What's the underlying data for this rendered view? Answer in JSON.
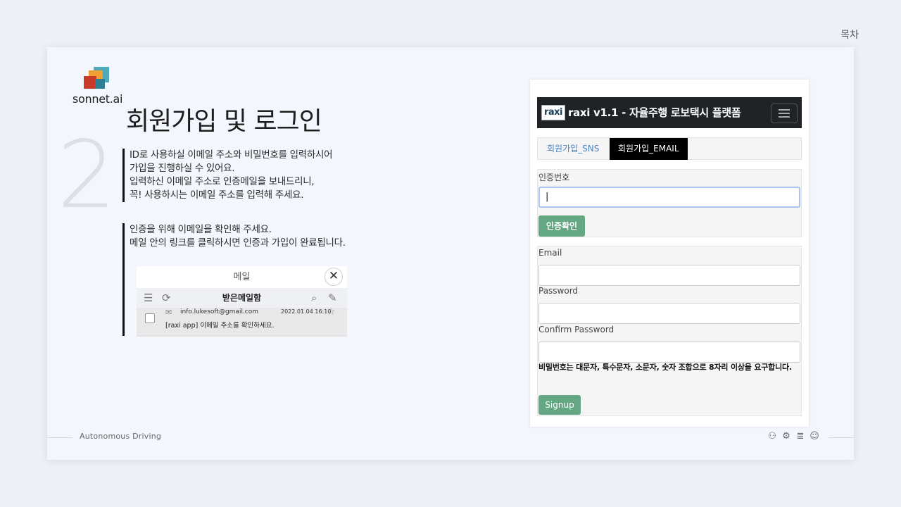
{
  "toc_label": "목차",
  "logo": {
    "text": "sonnet.ai"
  },
  "slide": {
    "title": "회원가입 및 로그인",
    "number": "2",
    "para1": [
      "ID로 사용하실 이메일 주소와 비밀번호를 입력하시어",
      "가입을 진행하실 수 있어요.",
      "입력하신 이메일 주소로 인증메일을 보내드리니,",
      "꼭! 사용하시는 이메일 주소를 입력해 주세요."
    ],
    "para2": [
      "인증을 위해 이메일을 확인해 주세요.",
      "메일 안의 링크를 클릭하시면 인증과 가입이 완료됩니다."
    ]
  },
  "mail": {
    "header": "메일",
    "close_icon": "✕",
    "inbox_title": "받은메일함",
    "from": "info.lukesoft@gmail.com",
    "date": "2022.01.04 16:10",
    "subject": "[raxi app] 이메일 주소를 확인하세요."
  },
  "app": {
    "logo_text": "raxi",
    "nav_title": "raxi v1.1 - 자율주행 로보택시 플랫폼",
    "tabs": [
      "회원가입_SNS",
      "회원가입_EMAIL"
    ],
    "verify_label": "인증번호",
    "verify_value": "|",
    "verify_button": "인증확인",
    "email_label": "Email",
    "password_label": "Password",
    "confirm_label": "Confirm Password",
    "password_note": "비밀번호는 대문자, 특수문자, 소문자, 숫자 조합으로 8자리 이상을 요구합니다.",
    "signup_button": "Signup"
  },
  "footer": {
    "text": "Autonomous Driving"
  },
  "colors": {
    "accent_green": "#63a882",
    "navbar": "#1f2326",
    "tab_active": "#000000",
    "link_blue": "#4a82c9"
  }
}
